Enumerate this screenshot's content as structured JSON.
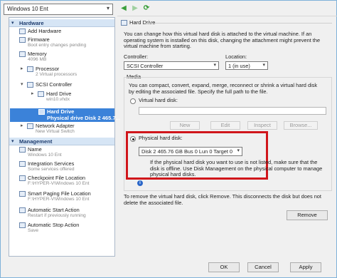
{
  "toolbar": {
    "vm_name": "Windows 10 Ent"
  },
  "sidebar": {
    "hardware_label": "Hardware",
    "management_label": "Management",
    "hardware_items": [
      {
        "label": "Add Hardware",
        "sub": ""
      },
      {
        "label": "Firmware",
        "sub": "Boot entry changes pending"
      },
      {
        "label": "Memory",
        "sub": "4096 MB"
      },
      {
        "label": "Processor",
        "sub": "2 Virtual processors"
      },
      {
        "label": "SCSI Controller",
        "sub": ""
      },
      {
        "label": "Hard Drive",
        "sub": "win10.vhdx"
      },
      {
        "label": "Hard Drive",
        "sub": "Physical drive Disk 2 465.7..."
      },
      {
        "label": "Network Adapter",
        "sub": "New Virtual Switch"
      }
    ],
    "management_items": [
      {
        "label": "Name",
        "sub": "Windows 10 Ent"
      },
      {
        "label": "Integration Services",
        "sub": "Some services offered"
      },
      {
        "label": "Checkpoint File Location",
        "sub": "F:\\HYPER-V\\Windows 10 Ent"
      },
      {
        "label": "Smart Paging File Location",
        "sub": "F:\\HYPER-V\\Windows 10 Ent"
      },
      {
        "label": "Automatic Start Action",
        "sub": "Restart if previously running"
      },
      {
        "label": "Automatic Stop Action",
        "sub": "Save"
      }
    ]
  },
  "panel": {
    "title": "Hard Drive",
    "intro_line1": "You can change how this virtual hard disk is attached to the virtual machine. If an",
    "intro_line2": "operating system is installed on this disk, changing the attachment might prevent the",
    "intro_line3": "virtual machine from starting.",
    "controller_label": "Controller:",
    "controller_value": "SCSI Controller",
    "location_label": "Location:",
    "location_value": "1 (in use)",
    "media_label": "Media",
    "media_desc_line1": "You can compact, convert, expand, merge, reconnect or shrink a virtual hard disk",
    "media_desc_line2": "by editing the associated file. Specify the full path to the file.",
    "virtual_hd_label": "Virtual hard disk:",
    "btn_new": "New",
    "btn_edit": "Edit",
    "btn_inspect": "Inspect",
    "btn_browse": "Browse...",
    "physical_hd_label": "Physical hard disk:",
    "physical_hd_value": "Disk 2 465.76 GB Bus 0 Lun 0 Target 0",
    "warn_line0": "If the physical hard disk you want to use is not listed, make sure that the",
    "warn_line1": "disk is offline. Use Disk Management on the physical computer to manage",
    "warn_line2": "physical hard disks.",
    "remove_line1": "To remove the virtual hard disk, click Remove. This disconnects the disk but does not",
    "remove_line2": "delete the associated file.",
    "btn_remove": "Remove"
  },
  "footer": {
    "ok": "OK",
    "cancel": "Cancel",
    "apply": "Apply"
  }
}
